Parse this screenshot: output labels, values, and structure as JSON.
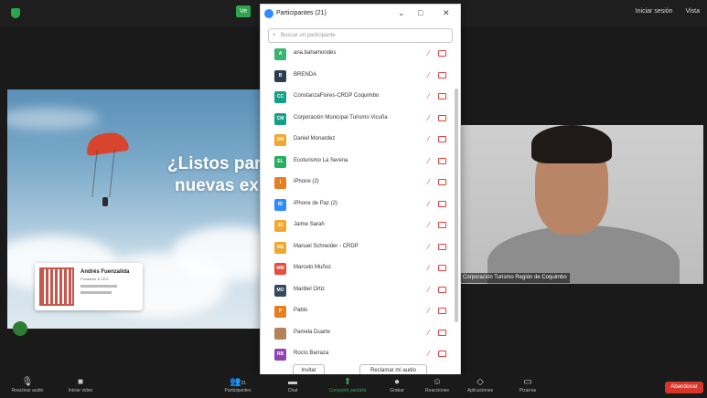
{
  "top_bar": {
    "recording_badge": "Ve",
    "right_items": [
      "Iniciar sesión",
      "Vista"
    ]
  },
  "shared_screen": {
    "title_line1": "¿Listos par",
    "title_line2": "nuevas ex",
    "card": {
      "name": "Andrés Fuenzalida",
      "role": "Fundador & CEO"
    }
  },
  "participants_panel": {
    "title": "Participantes (21)",
    "search_placeholder": "Buscar un participante",
    "participants": [
      {
        "initials": "A",
        "name": "ana.bahamondes",
        "color": "#3cb371"
      },
      {
        "initials": "B",
        "name": "BRENDA",
        "color": "#2c3e50"
      },
      {
        "initials": "CC",
        "name": "ConstanzaFlores-CRDP Coquimbo",
        "color": "#16a085"
      },
      {
        "initials": "CM",
        "name": "Corporación Municipal Turismo Vicuña",
        "color": "#16a085"
      },
      {
        "initials": "DM",
        "name": "Daniel Monardez",
        "color": "#f0a830"
      },
      {
        "initials": "EL",
        "name": "Ecoturismo La Serena",
        "color": "#27ae60"
      },
      {
        "initials": "I",
        "name": "iPhone (2)",
        "color": "#e67e22"
      },
      {
        "initials": "ID",
        "name": "iPhone de Paz (2)",
        "color": "#2d8cff"
      },
      {
        "initials": "JS",
        "name": "Jaime Sarah",
        "color": "#f0a830"
      },
      {
        "initials": "MS",
        "name": "Manuel Schneider - CRDP",
        "color": "#f0a830"
      },
      {
        "initials": "MM",
        "name": "Marcelo Muñoz",
        "color": "#e74c3c"
      },
      {
        "initials": "MO",
        "name": "Maribel Ortiz",
        "color": "#34495e"
      },
      {
        "initials": "P",
        "name": "Pablo",
        "color": "#e67e22"
      },
      {
        "initials": "",
        "name": "Pamela Duarte",
        "color": "#b5835a"
      },
      {
        "initials": "RB",
        "name": "Rocío Barraza",
        "color": "#8e44ad"
      }
    ],
    "invite_label": "Invitar",
    "reclaim_label": "Reclamar mi audio"
  },
  "video": {
    "participant_label": "Corporación Turismo Región de Coquimbo"
  },
  "toolbar": {
    "audio_label": "Reactivar audio",
    "video_label": "Iniciar video",
    "participants_label": "Participantes",
    "participants_count": "21",
    "chat_label": "Chat",
    "share_label": "Compartir pantalla",
    "record_label": "Grabar",
    "reactions_label": "Reacciones",
    "apps_label": "Aplicaciones",
    "whiteboards_label": "Pizarras",
    "end_label": "Abandonar"
  }
}
